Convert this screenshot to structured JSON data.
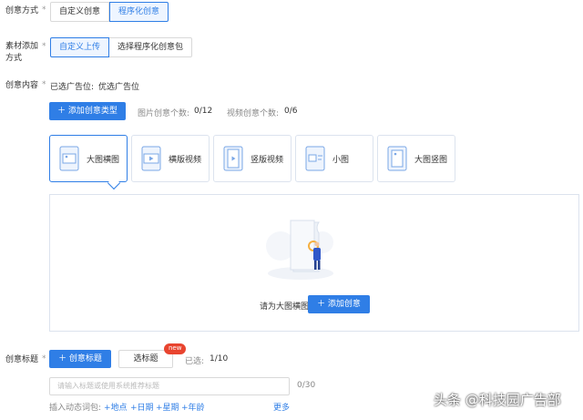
{
  "creative_mode": {
    "label": "创意方式",
    "required_mark": "*",
    "options": [
      "自定义创意",
      "程序化创意"
    ],
    "selected": "程序化创意"
  },
  "material_add": {
    "label_line1": "素材添加",
    "label_line2": "方式",
    "required_mark": "*",
    "options": [
      "自定义上传",
      "选择程序化创意包"
    ],
    "selected": "自定义上传"
  },
  "creative_content": {
    "label": "创意内容",
    "required_mark": "*",
    "selected_slot_label": "已选广告位:",
    "selected_slot_value": "优选广告位",
    "add_type_button": "＋ 添加创意类型",
    "image_count_label": "图片创意个数:",
    "image_count_value": "0/12",
    "video_count_label": "视频创意个数:",
    "video_count_value": "0/6",
    "types": [
      {
        "label": "大图横图",
        "icon": "image-landscape-icon",
        "active": true
      },
      {
        "label": "横版视频",
        "icon": "video-landscape-icon",
        "active": false
      },
      {
        "label": "竖版视频",
        "icon": "video-portrait-icon",
        "active": false
      },
      {
        "label": "小图",
        "icon": "image-small-icon",
        "active": false
      },
      {
        "label": "大图竖图",
        "icon": "image-portrait-icon",
        "active": false
      }
    ],
    "empty_hint": "请为大图横图",
    "add_creative_button": "＋ 添加创意"
  },
  "creative_title": {
    "label": "创意标题",
    "required_mark": "*",
    "add_title_button": "＋ 创意标题",
    "pick_title_button": "选标题",
    "new_badge": "new",
    "selected_label": "已选:",
    "selected_value": "1/10",
    "input_placeholder": "请输入标题或使用系统推荐标题",
    "char_count": "0/30",
    "dynamic_words_label": "插入动态词包:",
    "dynamic_words": [
      "+地点",
      "+日期",
      "+星期",
      "+年龄"
    ],
    "more_link": "更多"
  },
  "watermark": "头条 @科技园广告部",
  "colors": {
    "accent": "#2f7ee6",
    "badge": "#e8442f",
    "border": "#d9d9d9"
  }
}
